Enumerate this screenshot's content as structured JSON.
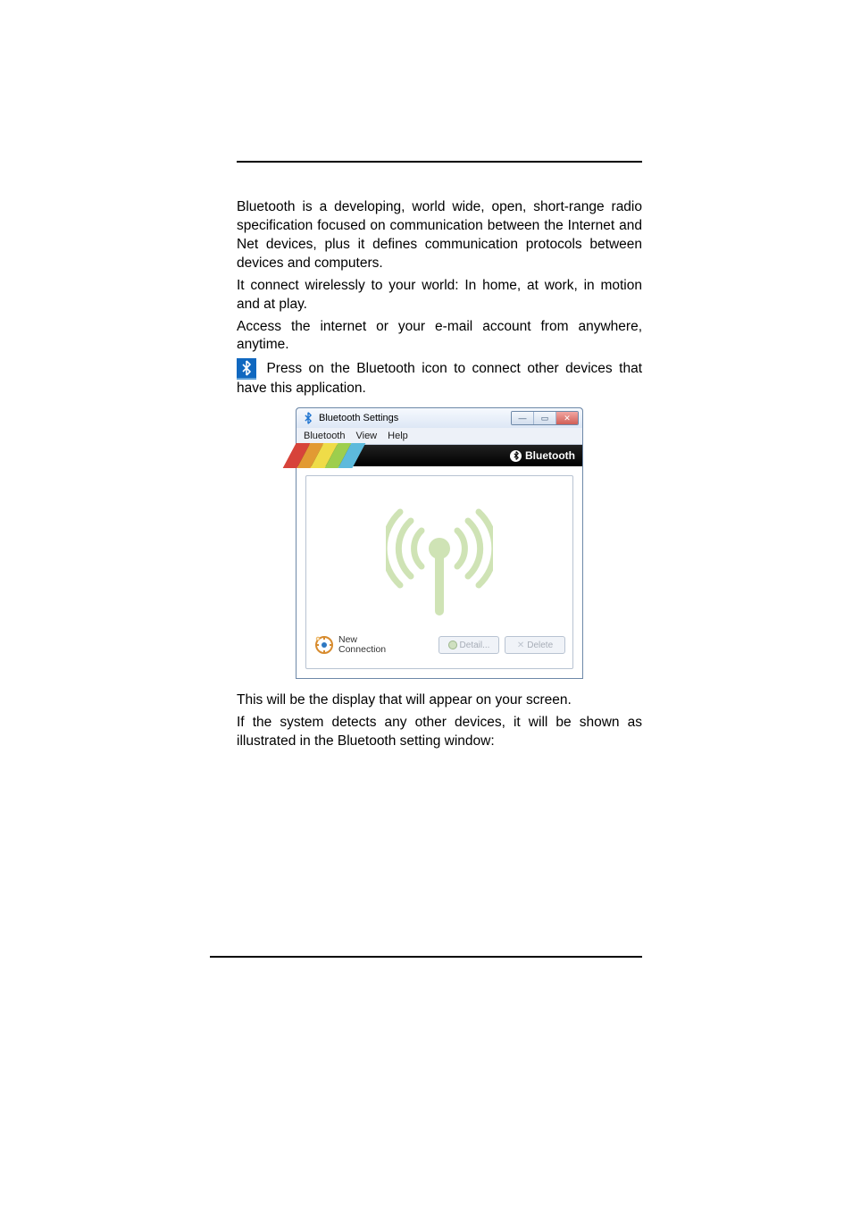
{
  "paragraphs": {
    "p1": "Bluetooth is a developing, world wide, open, short-range radio specification focused on communication between the Internet and Net devices, plus it defines communication protocols between devices and computers.",
    "p2": "It connect wirelessly to your world: In home, at work, in motion and at play.",
    "p3": "Access the internet or your e-mail account from anywhere, anytime.",
    "p4": " Press on the Bluetooth icon to connect other devices that have this application.",
    "p5": "This will be the display that will appear on your screen.",
    "p6": "If the system detects any other devices, it will be shown as illustrated in the Bluetooth setting window:"
  },
  "window": {
    "title": "Bluetooth Settings",
    "menu": {
      "m1": "Bluetooth",
      "m2": "View",
      "m3": "Help"
    },
    "brand": "Bluetooth",
    "new_conn_l1": "New",
    "new_conn_l2": "Connection",
    "btn_detail": "Detail...",
    "btn_delete": "Delete",
    "win_min": "—",
    "win_max": "▭",
    "win_close": "✕"
  }
}
